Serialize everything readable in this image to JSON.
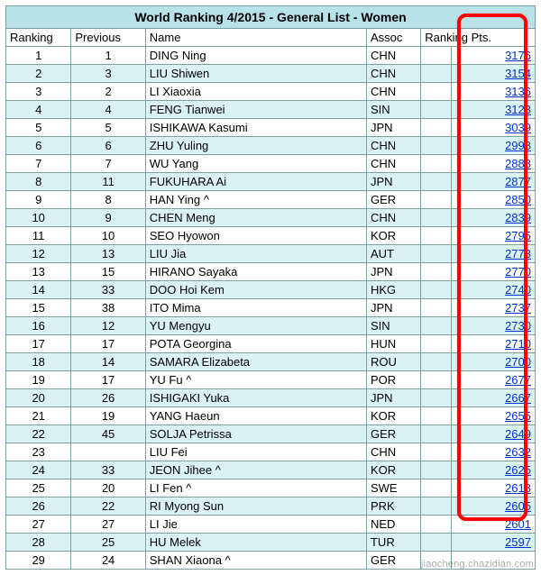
{
  "title": "World Ranking 4/2015 - General List - Women",
  "columns": [
    "Ranking",
    "Previous",
    "Name",
    "Assoc",
    "Ranking Pts."
  ],
  "watermark": "jiaocheng.chazidian.com",
  "rows": [
    {
      "rank": "1",
      "prev": "1",
      "name": "DING Ning",
      "assoc": "CHN",
      "pts": "3176"
    },
    {
      "rank": "2",
      "prev": "3",
      "name": "LIU Shiwen",
      "assoc": "CHN",
      "pts": "3154"
    },
    {
      "rank": "3",
      "prev": "2",
      "name": "LI Xiaoxia",
      "assoc": "CHN",
      "pts": "3136"
    },
    {
      "rank": "4",
      "prev": "4",
      "name": "FENG Tianwei",
      "assoc": "SIN",
      "pts": "3123"
    },
    {
      "rank": "5",
      "prev": "5",
      "name": "ISHIKAWA Kasumi",
      "assoc": "JPN",
      "pts": "3039"
    },
    {
      "rank": "6",
      "prev": "6",
      "name": "ZHU Yuling",
      "assoc": "CHN",
      "pts": "2998"
    },
    {
      "rank": "7",
      "prev": "7",
      "name": "WU Yang",
      "assoc": "CHN",
      "pts": "2888"
    },
    {
      "rank": "8",
      "prev": "11",
      "name": "FUKUHARA Ai",
      "assoc": "JPN",
      "pts": "2877"
    },
    {
      "rank": "9",
      "prev": "8",
      "name": "HAN Ying ^",
      "assoc": "GER",
      "pts": "2850"
    },
    {
      "rank": "10",
      "prev": "9",
      "name": "CHEN Meng",
      "assoc": "CHN",
      "pts": "2839"
    },
    {
      "rank": "11",
      "prev": "10",
      "name": "SEO Hyowon",
      "assoc": "KOR",
      "pts": "2795"
    },
    {
      "rank": "12",
      "prev": "13",
      "name": "LIU Jia",
      "assoc": "AUT",
      "pts": "2773"
    },
    {
      "rank": "13",
      "prev": "15",
      "name": "HIRANO Sayaka",
      "assoc": "JPN",
      "pts": "2770"
    },
    {
      "rank": "14",
      "prev": "33",
      "name": "DOO Hoi Kem",
      "assoc": "HKG",
      "pts": "2740"
    },
    {
      "rank": "15",
      "prev": "38",
      "name": "ITO Mima",
      "assoc": "JPN",
      "pts": "2737"
    },
    {
      "rank": "16",
      "prev": "12",
      "name": "YU Mengyu",
      "assoc": "SIN",
      "pts": "2730"
    },
    {
      "rank": "17",
      "prev": "17",
      "name": "POTA Georgina",
      "assoc": "HUN",
      "pts": "2710"
    },
    {
      "rank": "18",
      "prev": "14",
      "name": "SAMARA Elizabeta",
      "assoc": "ROU",
      "pts": "2700"
    },
    {
      "rank": "19",
      "prev": "17",
      "name": "YU Fu ^",
      "assoc": "POR",
      "pts": "2677"
    },
    {
      "rank": "20",
      "prev": "26",
      "name": "ISHIGAKI Yuka",
      "assoc": "JPN",
      "pts": "2667"
    },
    {
      "rank": "21",
      "prev": "19",
      "name": "YANG Haeun",
      "assoc": "KOR",
      "pts": "2655"
    },
    {
      "rank": "22",
      "prev": "45",
      "name": "SOLJA Petrissa",
      "assoc": "GER",
      "pts": "2649"
    },
    {
      "rank": "23",
      "prev": "",
      "name": "LIU Fei",
      "assoc": "CHN",
      "pts": "2632"
    },
    {
      "rank": "24",
      "prev": "33",
      "name": "JEON Jihee ^",
      "assoc": "KOR",
      "pts": "2625"
    },
    {
      "rank": "25",
      "prev": "20",
      "name": "LI Fen ^",
      "assoc": "SWE",
      "pts": "2618"
    },
    {
      "rank": "26",
      "prev": "22",
      "name": "RI Myong Sun",
      "assoc": "PRK",
      "pts": "2605"
    },
    {
      "rank": "27",
      "prev": "27",
      "name": "LI Jie",
      "assoc": "NED",
      "pts": "2601"
    },
    {
      "rank": "28",
      "prev": "25",
      "name": "HU Melek",
      "assoc": "TUR",
      "pts": "2597"
    },
    {
      "rank": "29",
      "prev": "24",
      "name": "SHAN Xiaona ^",
      "assoc": "GER",
      "pts": ""
    }
  ]
}
